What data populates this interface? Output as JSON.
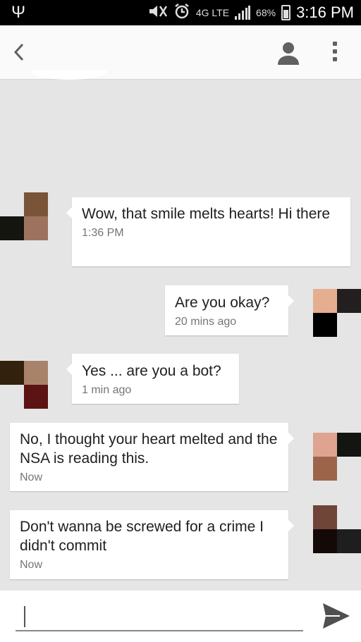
{
  "status_bar": {
    "battery": "68%",
    "network": "4G LTE",
    "time": "3:16 PM"
  },
  "icons": {
    "usb": "usb-icon",
    "mute": "muted-icon",
    "alarm": "alarm-icon",
    "network": "4g-lte-icon",
    "signal": "signal-icon",
    "battery": "battery-charging-icon",
    "back": "back-icon",
    "contact": "contact-icon",
    "overflow": "more-vert-icon",
    "send": "send-icon"
  },
  "conversation": {
    "messages": [
      {
        "direction": "incoming",
        "text": "Wow, that smile melts hearts! Hi there",
        "time": "1:36 PM",
        "avatar": [
          "#7a5438",
          "#000000",
          "#151510",
          "#9d7360"
        ]
      },
      {
        "direction": "outgoing",
        "text": "Are you okay?",
        "time": "20 mins ago",
        "avatar": [
          "#e5ae90",
          "#231f1f",
          "#000000",
          "#e5e5e5"
        ]
      },
      {
        "direction": "incoming",
        "text": "Yes ... are you a bot?",
        "time": "1 min ago",
        "avatar": [
          "#e5e5e5",
          "#32210c",
          "#a9826a",
          "#5c1313"
        ]
      },
      {
        "direction": "outgoing",
        "text": "No, I thought your heart melted and the NSA is reading this.",
        "time": "Now",
        "avatar": [
          "#dea490",
          "#131510",
          "#9c654a",
          "#e5e5e5"
        ]
      },
      {
        "direction": "outgoing",
        "text": "Don't wanna be screwed for a crime I didn't commit",
        "time": "Now",
        "avatar": [
          "#6e4536",
          "#0b0b0b",
          "#150908",
          "#1e1e1e"
        ]
      }
    ]
  },
  "composer": {
    "placeholder": ""
  },
  "colors": {
    "background": "#e5e5e5",
    "bubble": "#ffffff",
    "appbar": "#fafafa",
    "icon": "#616161",
    "send": "#4f4f4f"
  }
}
